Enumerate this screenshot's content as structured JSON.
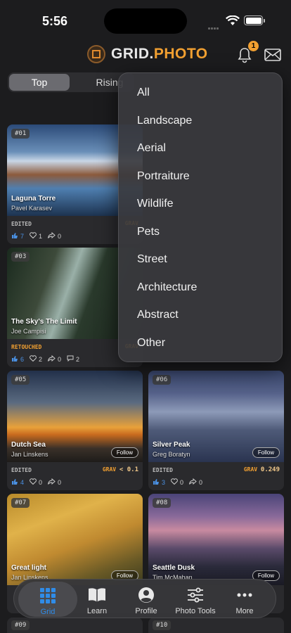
{
  "status_bar": {
    "time": "5:56",
    "battery_level": 1.0
  },
  "header": {
    "logo_part1": "GRID.",
    "logo_part2": "PHOTO",
    "notification_count": "1"
  },
  "segment": {
    "tabs": [
      "Top",
      "Rising"
    ],
    "selected": "Top"
  },
  "dropdown": {
    "items": [
      "All",
      "Landscape",
      "Aerial",
      "Portraiture",
      "Wildlife",
      "Pets",
      "Street",
      "Architecture",
      "Abstract",
      "Other"
    ]
  },
  "cards": [
    {
      "rank": "#01",
      "title": "Laguna Torre",
      "author": "Pavel Karasev",
      "edit": "EDITED",
      "grav": "GRAV",
      "grav_value": "",
      "likes": "7",
      "hearts": "1",
      "shares": "0",
      "comments": "",
      "follow": "",
      "liked": true
    },
    {
      "rank": "#03",
      "title": "The Sky's The Limit",
      "author": "Joe Campisi",
      "edit": "RETOUCHED",
      "grav": "GRAV",
      "grav_value": "",
      "likes": "6",
      "hearts": "2",
      "shares": "0",
      "comments": "2",
      "follow": "",
      "liked": true
    },
    {
      "rank": "#05",
      "title": "Dutch Sea",
      "author": "Jan Linskens",
      "edit": "EDITED",
      "grav": "GRAV",
      "grav_value": "< 0.1",
      "likes": "4",
      "hearts": "0",
      "shares": "0",
      "comments": "",
      "follow": "Follow",
      "liked": true
    },
    {
      "rank": "#06",
      "title": "Silver Peak",
      "author": "Greg Boratyn",
      "edit": "EDITED",
      "grav": "GRAV",
      "grav_value": "0.249",
      "likes": "3",
      "hearts": "0",
      "shares": "0",
      "comments": "",
      "follow": "Follow",
      "liked": true
    },
    {
      "rank": "#07",
      "title": "Great light",
      "author": "Jan Linskens",
      "edit": "",
      "grav": "",
      "grav_value": "",
      "likes": "",
      "hearts": "",
      "shares": "",
      "comments": "",
      "follow": "Follow",
      "liked": false
    },
    {
      "rank": "#08",
      "title": "Seattle Dusk",
      "author": "Tim McMahan",
      "edit": "",
      "grav": "",
      "grav_value": "",
      "likes": "",
      "hearts": "",
      "shares": "",
      "comments": "",
      "follow": "Follow",
      "liked": false
    }
  ],
  "peek_ranks": [
    "#09",
    "#10"
  ],
  "tabbar": {
    "tabs": [
      {
        "label": "Grid",
        "icon": "grid-icon"
      },
      {
        "label": "Learn",
        "icon": "book-icon"
      },
      {
        "label": "Profile",
        "icon": "person-icon"
      },
      {
        "label": "Photo Tools",
        "icon": "sliders-icon"
      },
      {
        "label": "More",
        "icon": "ellipsis-icon"
      }
    ],
    "active": "Grid"
  },
  "colors": {
    "accent": "#f2a031",
    "tab_active": "#2f8ce8",
    "like_blue": "#4a90e2"
  }
}
